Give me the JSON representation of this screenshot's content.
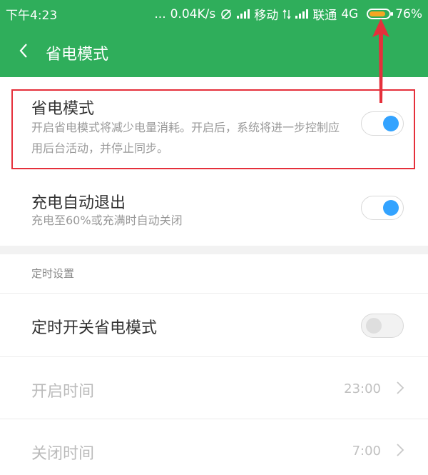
{
  "status_bar": {
    "time": "下午4:23",
    "dots": "...",
    "speed": "0.04K/s",
    "carrier1": "移动",
    "carrier2": "联通",
    "network": "4G",
    "battery": "76%"
  },
  "header": {
    "back_icon": "chevron-left-icon",
    "title": "省电模式",
    "bg_color": "#2fae5b"
  },
  "settings": {
    "power_saving": {
      "title": "省电模式",
      "desc": "开启省电模式将减少电量消耗。开启后，系统将进一步控制应用后台活动，并停止同步。",
      "enabled": true
    },
    "charge_exit": {
      "title": "充电自动退出",
      "desc": "充电至60%或充满时自动关闭",
      "enabled": true
    },
    "schedule_section": {
      "label": "定时设置",
      "toggle": {
        "title": "定时开关省电模式",
        "enabled": false
      },
      "start": {
        "title": "开启时间",
        "value": "23:00"
      },
      "end": {
        "title": "关闭时间",
        "value": "7:00"
      }
    }
  },
  "colors": {
    "accent": "#33a3ff",
    "highlight": "#e5303b"
  }
}
